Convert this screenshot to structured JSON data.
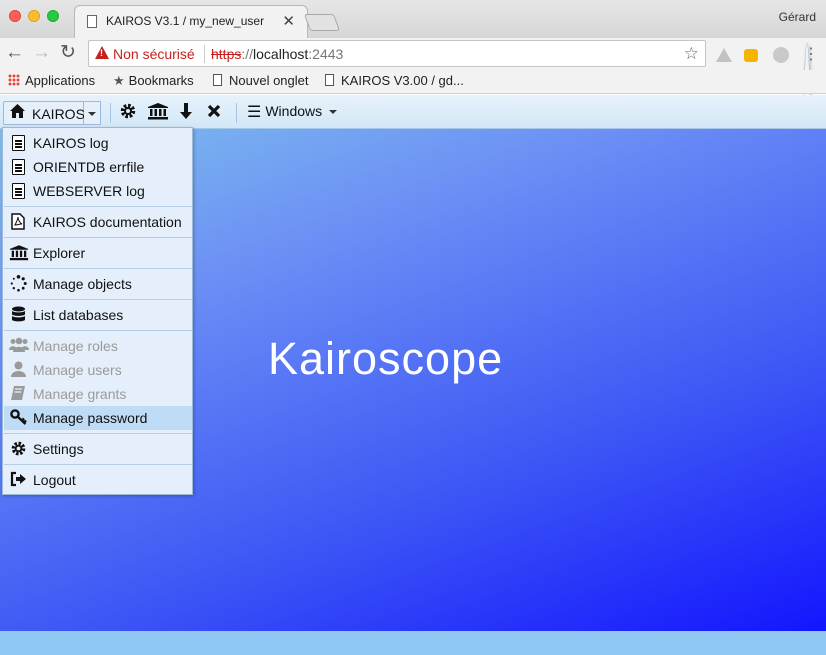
{
  "browser": {
    "tab_title": "KAIROS V3.1 / my_new_user",
    "tab_close": "✕",
    "user_name": "Gérard",
    "security_label": "Non sécurisé",
    "url_scheme": "https",
    "url_sep": "://",
    "url_host": "localhost",
    "url_port": ":2443",
    "back": "←",
    "forward": "→",
    "reload": "↻",
    "star": "☆",
    "menu": "⋮"
  },
  "bookmarks": {
    "apps": "Applications",
    "bookmarks": "Bookmarks",
    "new_tab": "Nouvel onglet",
    "kairos": "KAIROS V3.00 / gd..."
  },
  "appbar": {
    "kairos_label": "KAIROS",
    "windows_label": "Windows"
  },
  "menu": {
    "items": [
      {
        "label": "KAIROS log",
        "icon": "file-text-icon",
        "disabled": false
      },
      {
        "label": "ORIENTDB errfile",
        "icon": "file-text-icon",
        "disabled": false
      },
      {
        "label": "WEBSERVER log",
        "icon": "file-text-icon",
        "disabled": false
      },
      {
        "label": "KAIROS documentation",
        "icon": "file-pdf-icon",
        "disabled": false
      },
      {
        "label": "Explorer",
        "icon": "bank-icon",
        "disabled": false
      },
      {
        "label": "Manage objects",
        "icon": "spinner-icon",
        "disabled": false
      },
      {
        "label": "List databases",
        "icon": "database-icon",
        "disabled": false
      },
      {
        "label": "Manage roles",
        "icon": "users-icon",
        "disabled": true
      },
      {
        "label": "Manage users",
        "icon": "user-icon",
        "disabled": true
      },
      {
        "label": "Manage grants",
        "icon": "book-icon",
        "disabled": true
      },
      {
        "label": "Manage password",
        "icon": "key-icon",
        "disabled": false,
        "highlighted": true
      },
      {
        "label": "Settings",
        "icon": "gear-icon",
        "disabled": false
      },
      {
        "label": "Logout",
        "icon": "sign-out-icon",
        "disabled": false
      }
    ]
  },
  "brand": "Kairoscope",
  "colors": {
    "disabled_text": "#9a9a9a",
    "highlight": "#bfdcf7",
    "menu_bg": "#e4effb",
    "insecure_red": "#c5221f"
  }
}
